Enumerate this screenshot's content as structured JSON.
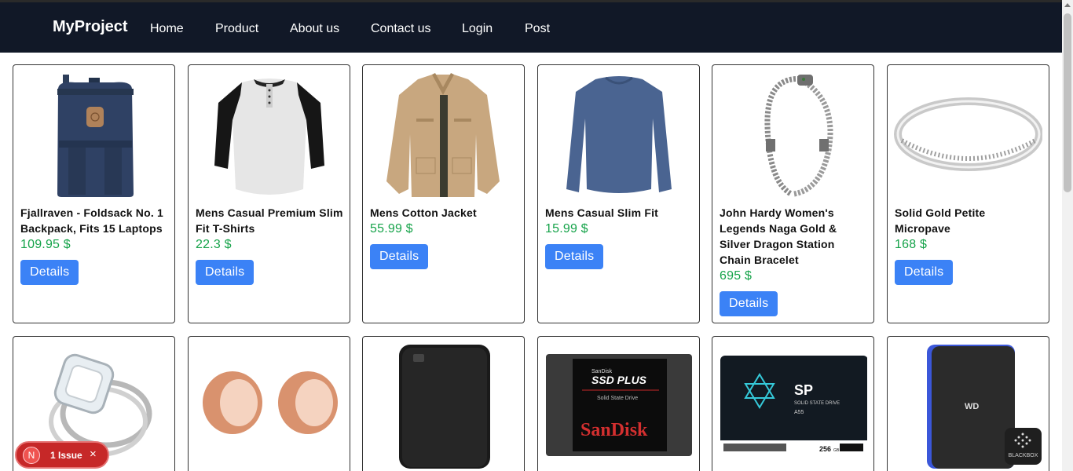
{
  "navbar": {
    "brand": "MyProject",
    "links": [
      "Home",
      "Product",
      "About us",
      "Contact us",
      "Login",
      "Post"
    ]
  },
  "products": [
    {
      "title": "Fjallraven - Foldsack No. 1 Backpack, Fits 15 Laptops",
      "price": "109.95 $",
      "button": "Details",
      "image": "backpack"
    },
    {
      "title": "Mens Casual Premium Slim Fit T-Shirts",
      "price": "22.3 $",
      "button": "Details",
      "image": "raglan-shirt"
    },
    {
      "title": "Mens Cotton Jacket",
      "price": "55.99 $",
      "button": "Details",
      "image": "jacket"
    },
    {
      "title": "Mens Casual Slim Fit",
      "price": "15.99 $",
      "button": "Details",
      "image": "longsleeve-shirt"
    },
    {
      "title": "John Hardy Women's Legends Naga Gold & Silver Dragon Station Chain Bracelet",
      "price": "695 $",
      "button": "Details",
      "image": "bracelet"
    },
    {
      "title": "Solid Gold Petite Micropave",
      "price": "168 $",
      "button": "Details",
      "image": "ring"
    },
    {
      "image": "diamond-ring"
    },
    {
      "image": "rose-gold-plugs"
    },
    {
      "image": "external-hard-drive"
    },
    {
      "image": "sandisk-ssd",
      "image_text": {
        "brand_small": "SanDisk",
        "model": "SSD PLUS",
        "sub": "Solid State Drive",
        "logo": "SanDisk"
      }
    },
    {
      "image": "sp-ssd",
      "image_text": {
        "brand": "SP",
        "sub": "SOLID STATE DRIVE",
        "model": "A55",
        "capacity": "256",
        "cap_unit": "GB"
      }
    },
    {
      "image": "gaming-drive",
      "image_text": {
        "logo": "WD"
      }
    }
  ],
  "issue_badge": {
    "avatar_letter": "N",
    "text": "1 Issue",
    "close": "×"
  },
  "blackbox": {
    "label": "BLACKBOX"
  },
  "colors": {
    "navbar": "#111827",
    "price": "#16a34a",
    "button": "#3b82f6",
    "issue": "#c62828"
  }
}
